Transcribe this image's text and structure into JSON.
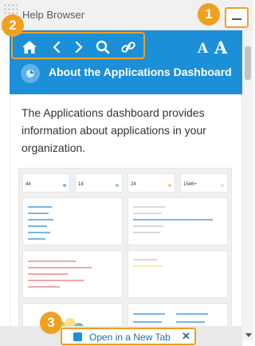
{
  "header": {
    "title": "Help Browser"
  },
  "toolbar": {
    "nav_icons": [
      "home-icon",
      "back-icon",
      "forward-icon",
      "search-icon",
      "link-icon"
    ],
    "font_small": "A",
    "font_large": "A"
  },
  "doc": {
    "title": "About the Applications Dashboard"
  },
  "content": {
    "paragraph": "The Applications dashboard provides information about applications in your organization.",
    "dashboard_numbers": [
      "44",
      "18",
      "24",
      "1546+"
    ]
  },
  "bottom": {
    "open_label": "Open in a New Tab",
    "close": "✕"
  },
  "callouts": [
    "1",
    "2",
    "3"
  ],
  "colors": {
    "accent": "#1b8fd8",
    "highlight": "#f0a020",
    "header_bg": "#f1f1f1"
  }
}
